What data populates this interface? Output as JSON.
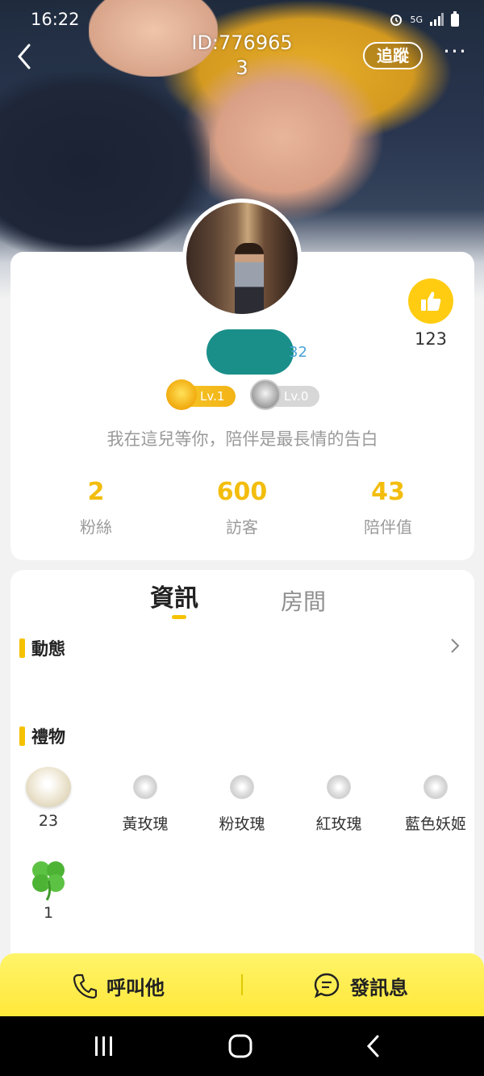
{
  "status_bar": {
    "time": "16:22",
    "network": "5G"
  },
  "header": {
    "profile_id": "ID:776965\n3",
    "follow_label": "追蹤",
    "more_label": "···"
  },
  "profile": {
    "name_level_num": "32",
    "likes": "123",
    "badges": [
      {
        "label": "Lv.1"
      },
      {
        "label": "Lv.0"
      }
    ],
    "bio": "我在這兒等你，陪伴是最長情的告白",
    "stats": [
      {
        "value": "2",
        "label": "粉絲"
      },
      {
        "value": "600",
        "label": "訪客"
      },
      {
        "value": "43",
        "label": "陪伴值"
      }
    ]
  },
  "tabs": {
    "info": "資訊",
    "room": "房間"
  },
  "sections": {
    "moments": "動態",
    "gifts": "禮物"
  },
  "gifts": [
    {
      "label": "23",
      "icon": "white-rose"
    },
    {
      "label": "黃玫瑰",
      "icon": "rose"
    },
    {
      "label": "粉玫瑰",
      "icon": "rose"
    },
    {
      "label": "紅玫瑰",
      "icon": "rose"
    },
    {
      "label": "藍色妖姬",
      "icon": "rose"
    },
    {
      "label": "1",
      "icon": "four-leaf-clover"
    }
  ],
  "actions": {
    "call": "呼叫他",
    "message": "發訊息"
  },
  "colors": {
    "accent": "#f3bd0d",
    "action_bar": "#ffe83a"
  }
}
